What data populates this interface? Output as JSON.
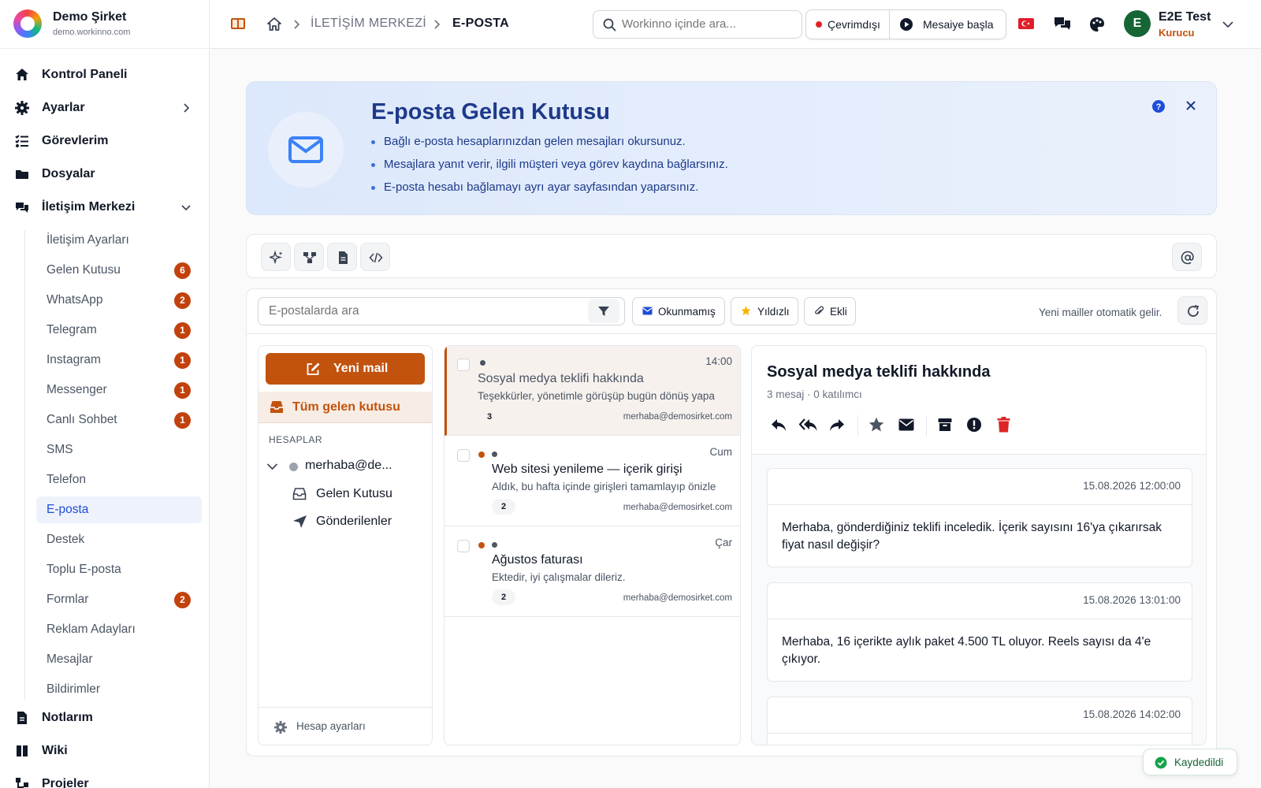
{
  "brand": {
    "name": "Demo Şirket",
    "domain": "demo.workinno.com"
  },
  "sidebar": {
    "main_top": [
      {
        "label": "Kontrol Paneli",
        "icon": "home-icon"
      },
      {
        "label": "Ayarlar",
        "icon": "gear-icon"
      },
      {
        "label": "Görevlerim",
        "icon": "list-check-icon"
      },
      {
        "label": "Dosyalar",
        "icon": "folder-icon"
      },
      {
        "label": "İletişim Merkezi",
        "icon": "chat-icon"
      }
    ],
    "sub": [
      {
        "label": "İletişim Ayarları",
        "badge": ""
      },
      {
        "label": "Gelen Kutusu",
        "badge": "6"
      },
      {
        "label": "WhatsApp",
        "badge": "2"
      },
      {
        "label": "Telegram",
        "badge": "1"
      },
      {
        "label": "Instagram",
        "badge": "1"
      },
      {
        "label": "Messenger",
        "badge": "1"
      },
      {
        "label": "Canlı Sohbet",
        "badge": "1"
      },
      {
        "label": "SMS",
        "badge": ""
      },
      {
        "label": "Telefon",
        "badge": ""
      },
      {
        "label": "E-posta",
        "badge": ""
      },
      {
        "label": "Destek",
        "badge": ""
      },
      {
        "label": "Toplu E-posta",
        "badge": ""
      },
      {
        "label": "Formlar",
        "badge": "2"
      },
      {
        "label": "Reklam Adayları",
        "badge": ""
      },
      {
        "label": "Mesajlar",
        "badge": ""
      },
      {
        "label": "Bildirimler",
        "badge": ""
      }
    ],
    "main_bottom": [
      {
        "label": "Notlarım",
        "icon": "note-icon"
      },
      {
        "label": "Wiki",
        "icon": "book-icon"
      },
      {
        "label": "Projeler",
        "icon": "project-icon"
      }
    ]
  },
  "topbar": {
    "breadcrumb": [
      "İLETİŞİM MERKEZİ",
      "E-POSTA"
    ],
    "search_placeholder": "Workinno içinde ara...",
    "status_label": "Çevrimdışı",
    "shift_label": "Mesaiye başla",
    "user_initial": "E",
    "user_name": "E2E Test",
    "user_role": "Kurucu"
  },
  "banner": {
    "title": "E-posta Gelen Kutusu",
    "bullets": [
      "Bağlı e-posta hesaplarınızdan gelen mesajları okursunuz.",
      "Mesajlara yanıt verir, ilgili müşteri veya görev kaydına bağlarsınız.",
      "E-posta hesabı bağlamayı ayrı ayar sayfasından yaparsınız."
    ]
  },
  "mail": {
    "search_placeholder": "E-postalarda ara",
    "filters": {
      "unread": "Okunmamış",
      "starred": "Yıldızlı",
      "attached": "Ekli"
    },
    "auto_note": "Yeni mailler otomatik gelir.",
    "new_mail": "Yeni mail",
    "all_inbox": "Tüm gelen kutusu",
    "accounts_header": "HESAPLAR",
    "account": "merhaba@de...",
    "inbox": "Gelen Kutusu",
    "sent": "Gönderilenler",
    "account_settings": "Hesap ayarları",
    "items": [
      {
        "time": "14:00",
        "subject": "Sosyal medya teklifi hakkında",
        "preview": "Teşekkürler, yönetimle görüşüp bugün dönüş yapa",
        "count": "3",
        "from": "merhaba@demosirket.com",
        "unread": false
      },
      {
        "time": "Cum",
        "subject": "Web sitesi yenileme — içerik girişi",
        "preview": "Aldık, bu hafta içinde girişleri tamamlayıp önizle",
        "count": "2",
        "from": "merhaba@demosirket.com",
        "unread": true
      },
      {
        "time": "Çar",
        "subject": "Ağustos faturası",
        "preview": "Ektedir, iyi çalışmalar dileriz.",
        "count": "2",
        "from": "merhaba@demosirket.com",
        "unread": true
      }
    ],
    "thread": {
      "subject": "Sosyal medya teklifi hakkında",
      "meta": "3 mesaj · 0 katılımcı",
      "messages": [
        {
          "date": "15.08.2026 12:00:00",
          "body": "Merhaba, gönderdiğiniz teklifi inceledik. İçerik sayısını 16'ya çıkarırsak fiyat nasıl değişir?"
        },
        {
          "date": "15.08.2026 13:01:00",
          "body": "Merhaba, 16 içerikte aylık paket 4.500 TL oluyor. Reels sayısı da 4'e çıkıyor."
        },
        {
          "date": "15.08.2026 14:02:00",
          "body": ""
        }
      ]
    }
  },
  "toast": {
    "label": "Kaydedildi"
  },
  "colors": {
    "accent": "#c2530e",
    "primary": "#1e3a8a",
    "badge": "#c2410c",
    "success": "#16a34a",
    "danger": "#dc2626"
  }
}
